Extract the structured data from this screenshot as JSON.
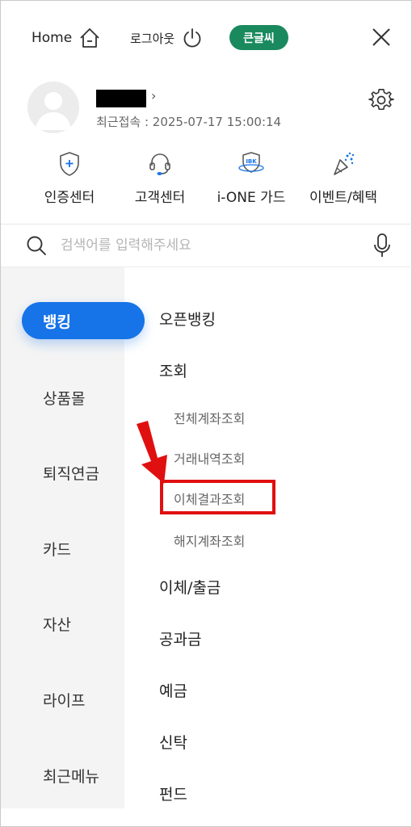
{
  "header": {
    "home_label": "Home",
    "logout_label": "로그아웃",
    "bigfont_label": "큰글씨"
  },
  "profile": {
    "last_login": "최근접속 : 2025-07-17 15:00:14",
    "chevron": "›"
  },
  "quick_menu": [
    {
      "label": "인증센터",
      "icon": "shield-plus-icon"
    },
    {
      "label": "고객센터",
      "icon": "headset-icon"
    },
    {
      "label": "i-ONE 가드",
      "icon": "ibk-guard-icon",
      "icon_text": "IBK"
    },
    {
      "label": "이벤트/혜택",
      "icon": "party-popper-icon"
    }
  ],
  "search": {
    "placeholder": "검색어를 입력해주세요"
  },
  "categories": [
    {
      "label": "뱅킹",
      "active": true
    },
    {
      "label": "상품몰",
      "active": false
    },
    {
      "label": "퇴직연금",
      "active": false
    },
    {
      "label": "카드",
      "active": false
    },
    {
      "label": "자산",
      "active": false
    },
    {
      "label": "라이프",
      "active": false
    },
    {
      "label": "최근메뉴",
      "active": false
    }
  ],
  "menu": {
    "open_banking": "오픈뱅킹",
    "inquiry": "조회",
    "inquiry_items": [
      "전체계좌조회",
      "거래내역조회",
      "이체결과조회",
      "해지계좌조회"
    ],
    "transfer": "이체/출금",
    "utility": "공과금",
    "deposit": "예금",
    "trust": "신탁",
    "fund": "펀드"
  },
  "colors": {
    "accent_blue": "#1773e8",
    "bigfont_green": "#1a8a5e",
    "highlight_red": "#e01010"
  }
}
